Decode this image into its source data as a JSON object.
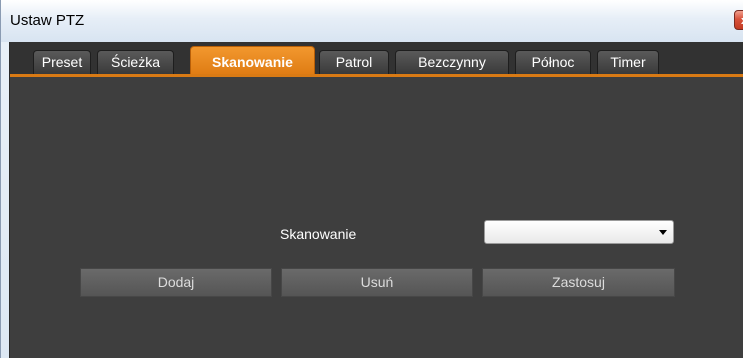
{
  "window": {
    "title": "Ustaw PTZ",
    "close_glyph": "x"
  },
  "tabs": [
    {
      "label": "Preset",
      "active": false
    },
    {
      "label": "Ścieżka",
      "active": false
    },
    {
      "label": "Skanowanie",
      "active": true
    },
    {
      "label": "Patrol",
      "active": false
    },
    {
      "label": "Bezczynny",
      "active": false
    },
    {
      "label": "Północ",
      "active": false
    },
    {
      "label": "Timer",
      "active": false
    }
  ],
  "form": {
    "scan_label": "Skanowanie",
    "scan_value": ""
  },
  "buttons": {
    "add": "Dodaj",
    "remove": "Usuń",
    "apply": "Zastosuj"
  },
  "colors": {
    "accent": "#de7a12",
    "panel": "#3e3e3e",
    "button": "#5c5c5c"
  },
  "icons": {
    "close": "close-icon",
    "dropdown": "chevron-down-icon"
  }
}
